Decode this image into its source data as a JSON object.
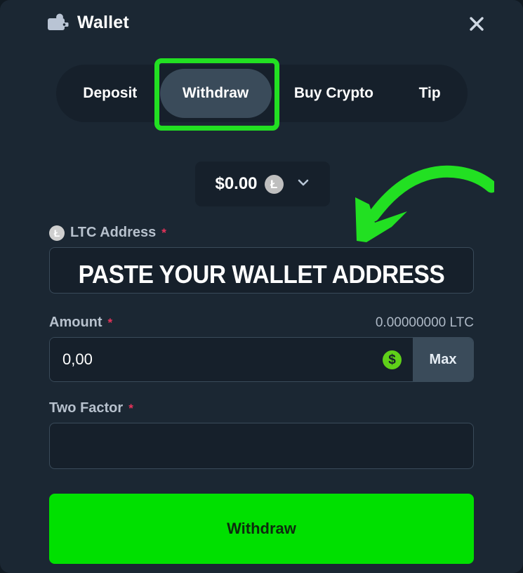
{
  "theme": {
    "modal_bg": "#1b2733",
    "panel_bg": "#16202b",
    "accent_green": "#00e000",
    "annotation_green": "#22e022",
    "required_red": "#e8335a",
    "slate": "#3a4b5a"
  },
  "header": {
    "title": "Wallet",
    "wallet_icon": "wallet-icon",
    "close_icon": "close-icon"
  },
  "tabs": [
    {
      "label": "Deposit",
      "active": false
    },
    {
      "label": "Withdraw",
      "active": true
    },
    {
      "label": "Buy Crypto",
      "active": false
    },
    {
      "label": "Tip",
      "active": false
    }
  ],
  "currency_selector": {
    "amount": "$0.00",
    "currency_symbol": "Ł",
    "currency_code": "LTC",
    "chevron_icon": "chevron-down-icon"
  },
  "form": {
    "address": {
      "label": "LTC Address",
      "required_marker": "*",
      "coin_icon": "ltc-coin-icon",
      "value": "",
      "placeholder": ""
    },
    "amount": {
      "label": "Amount",
      "required_marker": "*",
      "balance": "0.00000000 LTC",
      "value": "0,00",
      "placeholder": "0,00",
      "currency_toggle_icon": "dollar-icon",
      "currency_toggle_symbol": "$",
      "max_label": "Max"
    },
    "two_factor": {
      "label": "Two Factor",
      "required_marker": "*",
      "value": "",
      "placeholder": ""
    }
  },
  "submit": {
    "label": "Withdraw"
  },
  "annotations": {
    "paste_text": "PASTE YOUR WALLET ADDRESS",
    "highlight_target": "Withdraw",
    "arrow_icon": "curved-arrow-down-left-icon"
  }
}
